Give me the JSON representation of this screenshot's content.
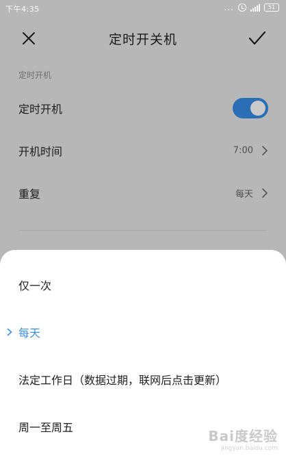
{
  "status_bar": {
    "time": "下午4:35",
    "dots": "...",
    "battery": "51"
  },
  "header": {
    "title": "定时开关机",
    "close_icon": "close-icon",
    "confirm_icon": "checkmark-icon"
  },
  "section": {
    "label": "定时开机"
  },
  "settings": {
    "power_on_label": "定时开机",
    "power_on_enabled": true,
    "power_on_time_label": "开机时间",
    "power_on_time_value": "7:00",
    "repeat_label": "重复",
    "repeat_value": "每天"
  },
  "repeat_options": [
    {
      "label": "仅一次",
      "selected": false
    },
    {
      "label": "每天",
      "selected": true
    },
    {
      "label": "法定工作日（数据过期，联网后点击更新）",
      "selected": false
    },
    {
      "label": "周一至周五",
      "selected": false
    }
  ],
  "watermark": {
    "main": "Bai度经验",
    "sub": "jingyan.baidu.com"
  },
  "colors": {
    "accent": "#3f8fd8",
    "toggle": "#2a6fb6",
    "dim_background": "#b7b7b7",
    "sheet": "#ffffff"
  }
}
